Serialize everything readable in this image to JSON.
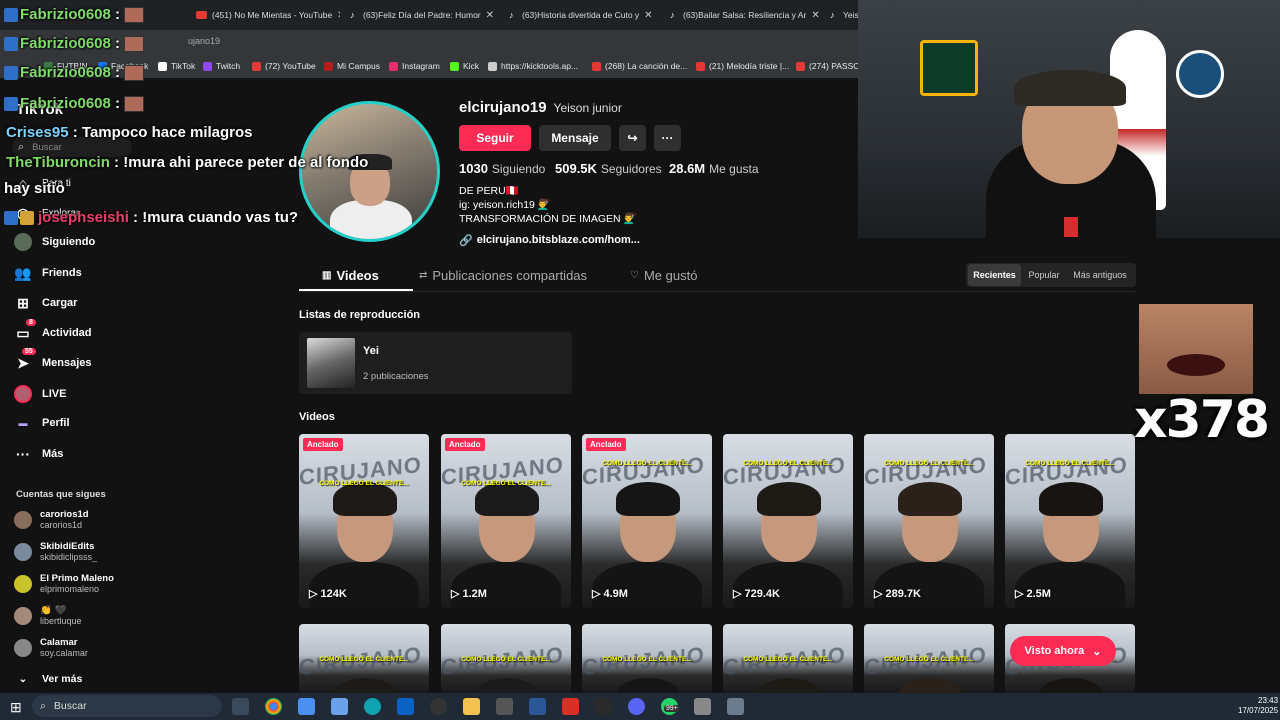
{
  "browser": {
    "tabs": [
      {
        "label": "Fabrizio0608 :"
      },
      {
        "label": "(451) No Me Mientas - YouTube"
      },
      {
        "label": "(63)Feliz Día del Padre: Humor"
      },
      {
        "label": "(63)Historia divertida de Cuto y"
      },
      {
        "label": "(63)Bailar Salsa: Resiliencia y Ar"
      },
      {
        "label": "Yeiso"
      }
    ],
    "url_text": "ujano19",
    "bookmarks": [
      {
        "label": "FUTBIN",
        "color": "#3a7d44"
      },
      {
        "label": "Facebook",
        "color": "#1877f2"
      },
      {
        "label": "TikTok",
        "color": "#ffffff"
      },
      {
        "label": "Twitch",
        "color": "#9146ff"
      },
      {
        "label": "(72) YouTube",
        "color": "#e53935"
      },
      {
        "label": "Mi Campus",
        "color": "#b71c1c"
      },
      {
        "label": "Instagram",
        "color": "#e1306c"
      },
      {
        "label": "Kick",
        "color": "#53fc18"
      },
      {
        "label": "https://kicktools.ap...",
        "color": "#cccccc"
      },
      {
        "label": "(268) La canción de...",
        "color": "#e53935"
      },
      {
        "label": "(21) Melodía triste |...",
        "color": "#e53935"
      },
      {
        "label": "(274) PASSO I",
        "color": "#e53935"
      }
    ]
  },
  "chat": [
    {
      "user": "Fabrizio0608",
      "sep": " :",
      "msg": ""
    },
    {
      "user": "Fabrizio0608",
      "sep": " :",
      "msg": ""
    },
    {
      "user": "Fabrizio0608",
      "sep": " :",
      "msg": ""
    },
    {
      "user": "Fabrizio0608",
      "sep": " :",
      "msg": ""
    },
    {
      "user": "Crises95",
      "sep": " :",
      "msg": " Tampoco hace milagros"
    },
    {
      "user": "TheTiburoncin",
      "sep": " :",
      "msg": " !mura ahi parece peter de al fondo"
    },
    {
      "user": "",
      "sep": "",
      "msg": "hay sitio"
    },
    {
      "user": "josephseishi",
      "sep": " :",
      "msg": " !mura cuando vas tu?"
    }
  ],
  "sidebar": {
    "logo": "TikTok",
    "search_placeholder": "Buscar",
    "items": [
      {
        "label": "Para ti"
      },
      {
        "label": "Explorar"
      },
      {
        "label": "Siguiendo"
      },
      {
        "label": "Friends"
      },
      {
        "label": "Cargar"
      },
      {
        "label": "Actividad",
        "badge": "8"
      },
      {
        "label": "Mensajes",
        "badge": "55"
      },
      {
        "label": "LIVE"
      },
      {
        "label": "Perfil"
      },
      {
        "label": "Más"
      }
    ],
    "following_title": "Cuentas que sigues",
    "following": [
      {
        "name": "carorios1d",
        "handle": "carorios1d",
        "color": "#8a6d5a"
      },
      {
        "name": "SkibidiEdits",
        "handle": "skibidiclipsss_",
        "color": "#7a8ba0"
      },
      {
        "name": "El Primo Maleno",
        "handle": "elprimomaleno",
        "color": "#c9c22a"
      },
      {
        "name": "👏 🖤",
        "handle": "libertluque",
        "color": "#a58a7a"
      },
      {
        "name": "Calamar",
        "handle": "soy.calamar",
        "color": "#888888"
      }
    ],
    "see_more": "Ver más"
  },
  "profile": {
    "username": "elcirujano19",
    "display_name": "Yeison junior",
    "follow_label": "Seguir",
    "message_label": "Mensaje",
    "stats": [
      {
        "value": "1030",
        "label": "Siguiendo"
      },
      {
        "value": "509.5K",
        "label": "Seguidores"
      },
      {
        "value": "28.6M",
        "label": "Me gusta"
      }
    ],
    "bio": [
      "DE PERU🇵🇪",
      "ig: yeison.rich19 💇‍♂️",
      "TRANSFORMACIÓN DE IMAGEN 💇‍♂️"
    ],
    "link": "elcirujano.bitsblaze.com/hom..."
  },
  "content_tabs": [
    {
      "label": "Videos",
      "icon": "grid-icon"
    },
    {
      "label": "Publicaciones compartidas",
      "icon": "repost-icon"
    },
    {
      "label": "Me gustó",
      "icon": "heart-icon"
    }
  ],
  "sort": [
    "Recientes",
    "Popular",
    "Más antiguos"
  ],
  "playlists_title": "Listas de reproducción",
  "playlist": {
    "name": "Yei",
    "count": "2 publicaciones"
  },
  "videos_title": "Videos",
  "pinned_label": "Anclado",
  "caption": "COMO LLEGÓ EL CLIENTE...",
  "wall_text": "CIRUJANO",
  "videos_row1": [
    {
      "views": "124K",
      "pinned": true
    },
    {
      "views": "1.2M",
      "pinned": true
    },
    {
      "views": "4.9M",
      "pinned": true
    },
    {
      "views": "729.4K",
      "pinned": false
    },
    {
      "views": "289.7K",
      "pinned": false
    },
    {
      "views": "2.5M",
      "pinned": false
    }
  ],
  "seen_now": "Visto ahora",
  "overlay_counter": "x378",
  "taskbar": {
    "search": "Buscar",
    "time": "23:43",
    "date": "17/07/2025",
    "badge": "99+"
  }
}
